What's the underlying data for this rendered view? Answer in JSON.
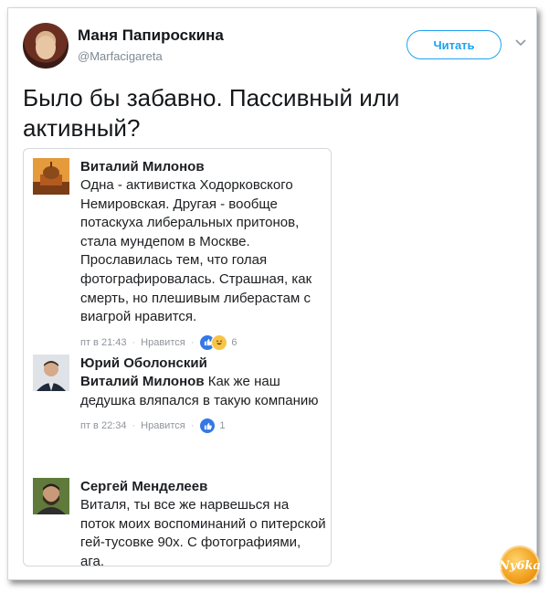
{
  "tweet": {
    "author_name": "Маня Папироскина",
    "author_handle": "@Marfacigareta",
    "follow_label": "Читать",
    "text": "Было бы забавно. Пассивный или активный?"
  },
  "comments": [
    {
      "author": "Виталий Милонов",
      "mention": "",
      "text": "Одна - активистка Ходорковского Немировская. Другая - вообще потаскуха либеральных притонов, стала мундепом в Москве. Прославилась тем, что голая фотографировалась. Страшная, как смерть, но плешивым либерастам с виагрой нравится.",
      "time": "пт в 21:43",
      "like_label": "Нравится",
      "reaction_count": "6",
      "reactions": [
        "like-icon",
        "haha-icon"
      ]
    },
    {
      "author": "Юрий Оболонский",
      "mention": "Виталий Милонов",
      "text": " Как же наш дедушка вляпался в такую компанию",
      "time": "пт в 22:34",
      "like_label": "Нравится",
      "reaction_count": "1",
      "reactions": [
        "like-icon"
      ]
    },
    {
      "author": "Сергей Менделеев",
      "mention": "",
      "text": "Виталя, ты все же нарвешься на поток моих воспоминаний о питерской гей-тусовке 90х. С фотографиями, ага."
    }
  ],
  "watermark": {
    "logo_text": "Ny6ka"
  },
  "colors": {
    "accent": "#1da1f2",
    "fb_like": "#3578e5",
    "muted": "#90949c"
  }
}
